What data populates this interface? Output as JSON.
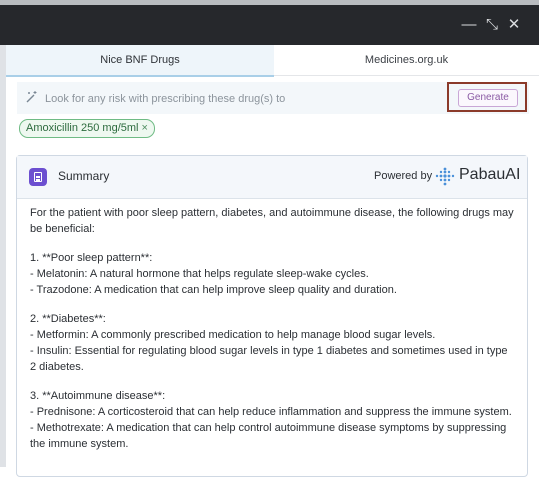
{
  "window": {
    "minimize_label": "—",
    "restore_label": "⤡",
    "close_label": "✕"
  },
  "tabs": [
    {
      "label": "Nice BNF Drugs",
      "active": true
    },
    {
      "label": "Medicines.org.uk",
      "active": false
    }
  ],
  "search": {
    "icon": "magic-wand-icon",
    "placeholder": "Look for any risk with prescribing these drug(s) to",
    "value": ""
  },
  "generate_label": "Generate",
  "chips": [
    {
      "label": "Amoxicillin 250 mg/5ml"
    }
  ],
  "chip_remove_label": "×",
  "summary": {
    "title": "Summary",
    "powered_by": "Powered by",
    "brand": "PabauAI",
    "lines": [
      "For the patient with poor sleep pattern, diabetes, and autoimmune disease, the following drugs may be beneficial:",
      "",
      "1. **Poor sleep pattern**:",
      "- Melatonin: A natural hormone that helps regulate sleep-wake cycles.",
      "- Trazodone: A medication that can help improve sleep quality and duration.",
      "",
      "2. **Diabetes**:",
      "- Metformin: A commonly prescribed medication to help manage blood sugar levels.",
      "- Insulin: Essential for regulating blood sugar levels in type 1 diabetes and sometimes used in type 2 diabetes.",
      "",
      "3. **Autoimmune disease**:",
      "- Prednisone: A corticosteroid that can help reduce inflammation and suppress the immune system.",
      "- Methotrexate: A medication that can help control autoimmune disease symptoms by suppressing the immune system."
    ]
  },
  "colors": {
    "titlebar": "#26282c",
    "active_tab": "#eef5fa",
    "generate_outline": "#8b3a2a",
    "generate_text": "#8a5aa4",
    "chip_border": "#6fbb84",
    "summary_icon": "#6c4fd0"
  }
}
